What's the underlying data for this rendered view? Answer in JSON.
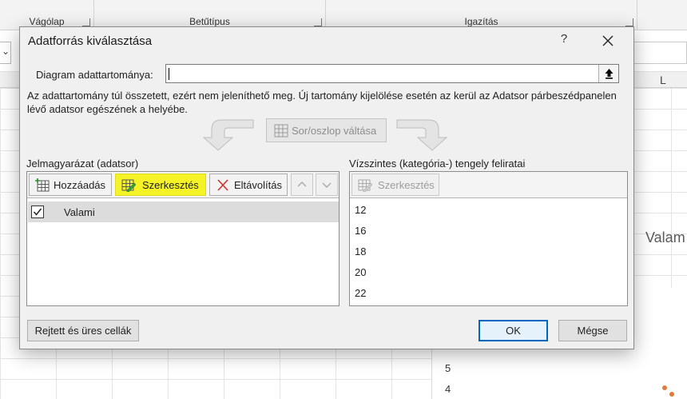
{
  "excel": {
    "ribbon": {
      "group_clipboard": "Vágólap",
      "group_font": "Betűtípus",
      "group_alignment": "Igazítás"
    },
    "column_L": "L",
    "chart_title_partial": "Valam",
    "axis_values": [
      "5",
      "4"
    ]
  },
  "dialog": {
    "title": "Adatforrás kiválasztása",
    "help": "?",
    "range_label": "Diagram adattartománya:",
    "range_value": "",
    "warning": "Az adattartomány túl összetett, ezért nem jeleníthető meg. Új tartomány kijelölése esetén az kerül az Adatsor párbeszédpanelen lévő adatsor egészének a helyébe.",
    "switch_button": "Sor/oszlop váltása",
    "legend_section": "Jelmagyarázat (adatsor)",
    "axis_section": "Vízszintes (kategória-) tengely feliratai",
    "legend_toolbar": {
      "add": "Hozzáadás",
      "edit": "Szerkesztés",
      "remove": "Eltávolítás"
    },
    "axis_toolbar": {
      "edit": "Szerkesztés"
    },
    "series": [
      {
        "name": "Valami",
        "checked": true
      }
    ],
    "axis_labels": [
      "12",
      "16",
      "18",
      "20",
      "22"
    ],
    "hidden_cells_button": "Rejtett és üres cellák",
    "ok_button": "OK",
    "cancel_button": "Mégse"
  },
  "colors": {
    "highlight": "#f5f227",
    "ok_border": "#0067c0",
    "remove_icon": "#d03030"
  }
}
